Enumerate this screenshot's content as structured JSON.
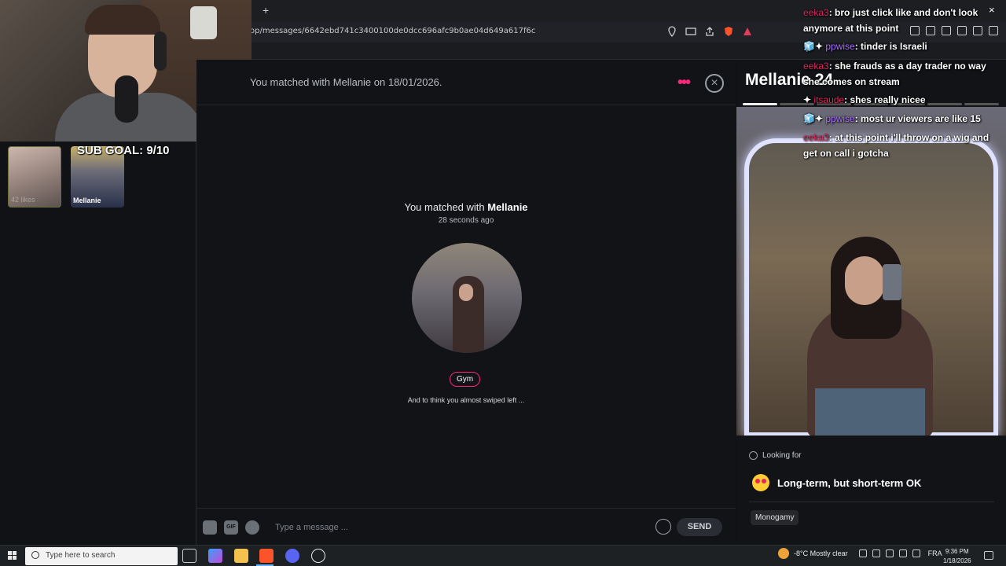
{
  "browser": {
    "new_tab": "+",
    "url": "op/messages/6642ebd741c3400100de0dcc696afc9b0ae04d649a617f6c"
  },
  "stream": {
    "sub_goal": "SUB GOAL: 9/10",
    "thumbs": [
      {
        "caption": "42 likes"
      },
      {
        "caption": "Mellanie"
      }
    ]
  },
  "chat": {
    "header_match": "You matched with Mellanie on 18/01/2026.",
    "more_label": "•••",
    "close_label": "×",
    "match_title_prefix": "You matched with ",
    "match_name": "Mellanie",
    "match_time": "28 seconds ago",
    "interest": "Gym",
    "tagline": "And to think you almost swiped left ...",
    "composer": {
      "gif_label": "GIF",
      "placeholder": "Type a message ...",
      "send_label": "SEND"
    }
  },
  "profile": {
    "name": "Mellanie 24",
    "photo_count": 7,
    "active_photo": 0,
    "looking_for_label": "Looking for",
    "looking_for_value": "Long-term, but short-term OK",
    "relationship_type": "Monogamy"
  },
  "overlay_chat": [
    {
      "user": "eeka3",
      "user_color": "#e0245e",
      "badges": "",
      "text": ": bro just click like and don't look",
      "cont": "anymore at this point"
    },
    {
      "user": "ppwise",
      "user_color": "#a970ff",
      "badges": "🧊✦",
      "text": ": tinder is Israeli",
      "cont": ""
    },
    {
      "user": "eeka3",
      "user_color": "#e0245e",
      "badges": "",
      "text": ": she frauds as a day trader no way",
      "cont": "she comes on stream"
    },
    {
      "user": "itsaude",
      "user_color": "#e0245e",
      "badges": "✦",
      "text": ": shes really nicee",
      "cont": ""
    },
    {
      "user": "ppwise",
      "user_color": "#a970ff",
      "badges": "🧊✦",
      "text": ": most ur viewers are like 15",
      "cont": ""
    },
    {
      "user": "eeka3",
      "user_color": "#e0245e",
      "badges": "",
      "text": ": at this point i'll throw on a wig and",
      "cont": "get on call i gotcha"
    }
  ],
  "overlay_close": "×",
  "taskbar": {
    "search_placeholder": "Type here to search",
    "weather": "-8°C  Mostly clear",
    "language": "FRA",
    "time": "9:36 PM",
    "date": "1/18/2026"
  },
  "colors": {
    "accent": "#fd267d",
    "panel": "#111317",
    "background": "#0f1114"
  }
}
